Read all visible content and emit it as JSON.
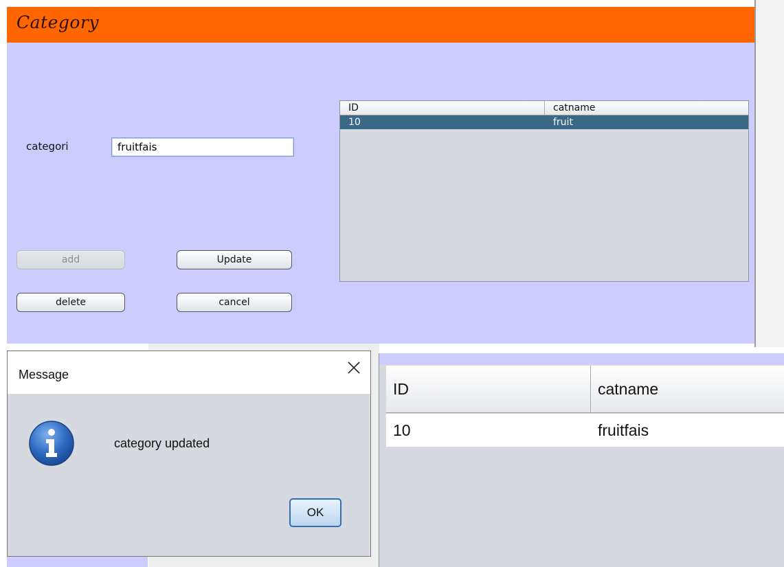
{
  "window": {
    "title": "Category",
    "colors": {
      "title_bar": "#ff6600",
      "background": "#ccccff",
      "selection": "#3a6988"
    }
  },
  "form": {
    "category_label": "categori",
    "category_value": "fruitfais"
  },
  "buttons": {
    "add": "add",
    "update": "Update",
    "delete": "delete",
    "cancel": "cancel"
  },
  "table": {
    "columns": [
      "ID",
      "catname"
    ],
    "rows": [
      {
        "id": "10",
        "catname": "fruit"
      }
    ]
  },
  "dialog": {
    "title": "Message",
    "message": "category updated",
    "ok_label": "OK",
    "icon": "info-icon"
  },
  "result_table": {
    "columns": [
      "ID",
      "catname"
    ],
    "rows": [
      {
        "id": "10",
        "catname": "fruitfais"
      }
    ]
  }
}
